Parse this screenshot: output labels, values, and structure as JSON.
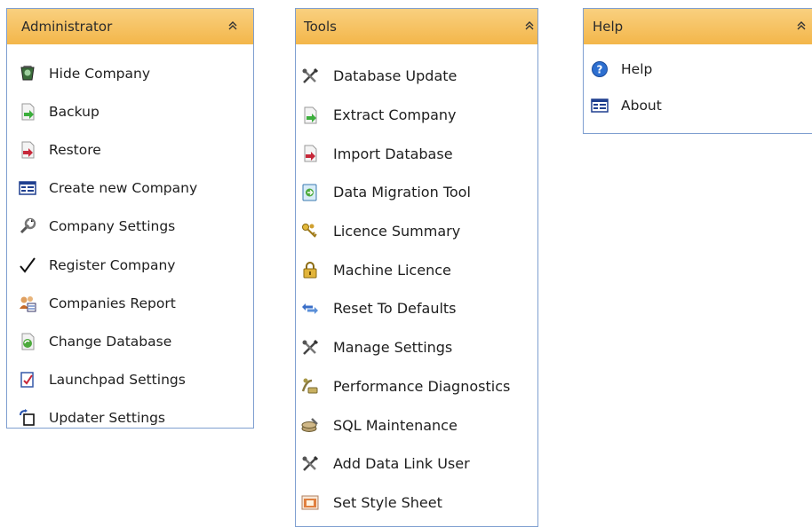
{
  "admin": {
    "title": "Administrator",
    "collapse": "«",
    "items": [
      {
        "label": "Hide Company",
        "icon": "hide-company-icon"
      },
      {
        "label": "Backup",
        "icon": "backup-icon"
      },
      {
        "label": "Restore",
        "icon": "restore-icon"
      },
      {
        "label": "Create new Company",
        "icon": "create-company-icon"
      },
      {
        "label": "Company Settings",
        "icon": "company-settings-icon"
      },
      {
        "label": "Register Company",
        "icon": "checkmark-icon"
      },
      {
        "label": "Companies Report",
        "icon": "companies-report-icon"
      },
      {
        "label": "Change Database",
        "icon": "change-database-icon"
      },
      {
        "label": "Launchpad Settings",
        "icon": "launchpad-settings-icon"
      },
      {
        "label": "Updater Settings",
        "icon": "updater-settings-icon"
      }
    ]
  },
  "tools": {
    "title": "Tools",
    "collapse": "«",
    "items": [
      {
        "label": "Database Update",
        "icon": "tools-icon"
      },
      {
        "label": "Extract Company",
        "icon": "extract-icon"
      },
      {
        "label": "Import Database",
        "icon": "import-icon"
      },
      {
        "label": "Data Migration Tool",
        "icon": "data-migration-icon"
      },
      {
        "label": "Licence Summary",
        "icon": "keys-icon"
      },
      {
        "label": "Machine Licence",
        "icon": "padlock-icon"
      },
      {
        "label": "Reset To Defaults",
        "icon": "reset-arrows-icon"
      },
      {
        "label": "Manage Settings",
        "icon": "tools-icon"
      },
      {
        "label": "Performance Diagnostics",
        "icon": "diagnostics-icon"
      },
      {
        "label": "SQL Maintenance",
        "icon": "sql-maintenance-icon"
      },
      {
        "label": "Add Data Link User",
        "icon": "tools-icon"
      },
      {
        "label": "Set Style Sheet",
        "icon": "style-sheet-icon"
      }
    ]
  },
  "help": {
    "title": "Help",
    "collapse": "«",
    "items": [
      {
        "label": "Help",
        "icon": "help-icon"
      },
      {
        "label": "About",
        "icon": "about-icon"
      }
    ]
  }
}
